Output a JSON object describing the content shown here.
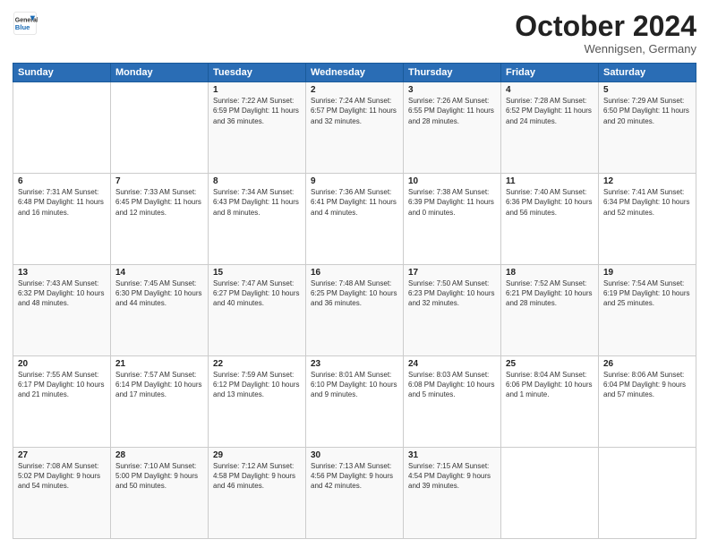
{
  "header": {
    "logo_general": "General",
    "logo_blue": "Blue",
    "month_title": "October 2024",
    "location": "Wennigsen, Germany"
  },
  "weekdays": [
    "Sunday",
    "Monday",
    "Tuesday",
    "Wednesday",
    "Thursday",
    "Friday",
    "Saturday"
  ],
  "weeks": [
    [
      {
        "day": "",
        "info": ""
      },
      {
        "day": "",
        "info": ""
      },
      {
        "day": "1",
        "info": "Sunrise: 7:22 AM\nSunset: 6:59 PM\nDaylight: 11 hours\nand 36 minutes."
      },
      {
        "day": "2",
        "info": "Sunrise: 7:24 AM\nSunset: 6:57 PM\nDaylight: 11 hours\nand 32 minutes."
      },
      {
        "day": "3",
        "info": "Sunrise: 7:26 AM\nSunset: 6:55 PM\nDaylight: 11 hours\nand 28 minutes."
      },
      {
        "day": "4",
        "info": "Sunrise: 7:28 AM\nSunset: 6:52 PM\nDaylight: 11 hours\nand 24 minutes."
      },
      {
        "day": "5",
        "info": "Sunrise: 7:29 AM\nSunset: 6:50 PM\nDaylight: 11 hours\nand 20 minutes."
      }
    ],
    [
      {
        "day": "6",
        "info": "Sunrise: 7:31 AM\nSunset: 6:48 PM\nDaylight: 11 hours\nand 16 minutes."
      },
      {
        "day": "7",
        "info": "Sunrise: 7:33 AM\nSunset: 6:45 PM\nDaylight: 11 hours\nand 12 minutes."
      },
      {
        "day": "8",
        "info": "Sunrise: 7:34 AM\nSunset: 6:43 PM\nDaylight: 11 hours\nand 8 minutes."
      },
      {
        "day": "9",
        "info": "Sunrise: 7:36 AM\nSunset: 6:41 PM\nDaylight: 11 hours\nand 4 minutes."
      },
      {
        "day": "10",
        "info": "Sunrise: 7:38 AM\nSunset: 6:39 PM\nDaylight: 11 hours\nand 0 minutes."
      },
      {
        "day": "11",
        "info": "Sunrise: 7:40 AM\nSunset: 6:36 PM\nDaylight: 10 hours\nand 56 minutes."
      },
      {
        "day": "12",
        "info": "Sunrise: 7:41 AM\nSunset: 6:34 PM\nDaylight: 10 hours\nand 52 minutes."
      }
    ],
    [
      {
        "day": "13",
        "info": "Sunrise: 7:43 AM\nSunset: 6:32 PM\nDaylight: 10 hours\nand 48 minutes."
      },
      {
        "day": "14",
        "info": "Sunrise: 7:45 AM\nSunset: 6:30 PM\nDaylight: 10 hours\nand 44 minutes."
      },
      {
        "day": "15",
        "info": "Sunrise: 7:47 AM\nSunset: 6:27 PM\nDaylight: 10 hours\nand 40 minutes."
      },
      {
        "day": "16",
        "info": "Sunrise: 7:48 AM\nSunset: 6:25 PM\nDaylight: 10 hours\nand 36 minutes."
      },
      {
        "day": "17",
        "info": "Sunrise: 7:50 AM\nSunset: 6:23 PM\nDaylight: 10 hours\nand 32 minutes."
      },
      {
        "day": "18",
        "info": "Sunrise: 7:52 AM\nSunset: 6:21 PM\nDaylight: 10 hours\nand 28 minutes."
      },
      {
        "day": "19",
        "info": "Sunrise: 7:54 AM\nSunset: 6:19 PM\nDaylight: 10 hours\nand 25 minutes."
      }
    ],
    [
      {
        "day": "20",
        "info": "Sunrise: 7:55 AM\nSunset: 6:17 PM\nDaylight: 10 hours\nand 21 minutes."
      },
      {
        "day": "21",
        "info": "Sunrise: 7:57 AM\nSunset: 6:14 PM\nDaylight: 10 hours\nand 17 minutes."
      },
      {
        "day": "22",
        "info": "Sunrise: 7:59 AM\nSunset: 6:12 PM\nDaylight: 10 hours\nand 13 minutes."
      },
      {
        "day": "23",
        "info": "Sunrise: 8:01 AM\nSunset: 6:10 PM\nDaylight: 10 hours\nand 9 minutes."
      },
      {
        "day": "24",
        "info": "Sunrise: 8:03 AM\nSunset: 6:08 PM\nDaylight: 10 hours\nand 5 minutes."
      },
      {
        "day": "25",
        "info": "Sunrise: 8:04 AM\nSunset: 6:06 PM\nDaylight: 10 hours\nand 1 minute."
      },
      {
        "day": "26",
        "info": "Sunrise: 8:06 AM\nSunset: 6:04 PM\nDaylight: 9 hours\nand 57 minutes."
      }
    ],
    [
      {
        "day": "27",
        "info": "Sunrise: 7:08 AM\nSunset: 5:02 PM\nDaylight: 9 hours\nand 54 minutes."
      },
      {
        "day": "28",
        "info": "Sunrise: 7:10 AM\nSunset: 5:00 PM\nDaylight: 9 hours\nand 50 minutes."
      },
      {
        "day": "29",
        "info": "Sunrise: 7:12 AM\nSunset: 4:58 PM\nDaylight: 9 hours\nand 46 minutes."
      },
      {
        "day": "30",
        "info": "Sunrise: 7:13 AM\nSunset: 4:56 PM\nDaylight: 9 hours\nand 42 minutes."
      },
      {
        "day": "31",
        "info": "Sunrise: 7:15 AM\nSunset: 4:54 PM\nDaylight: 9 hours\nand 39 minutes."
      },
      {
        "day": "",
        "info": ""
      },
      {
        "day": "",
        "info": ""
      }
    ]
  ]
}
